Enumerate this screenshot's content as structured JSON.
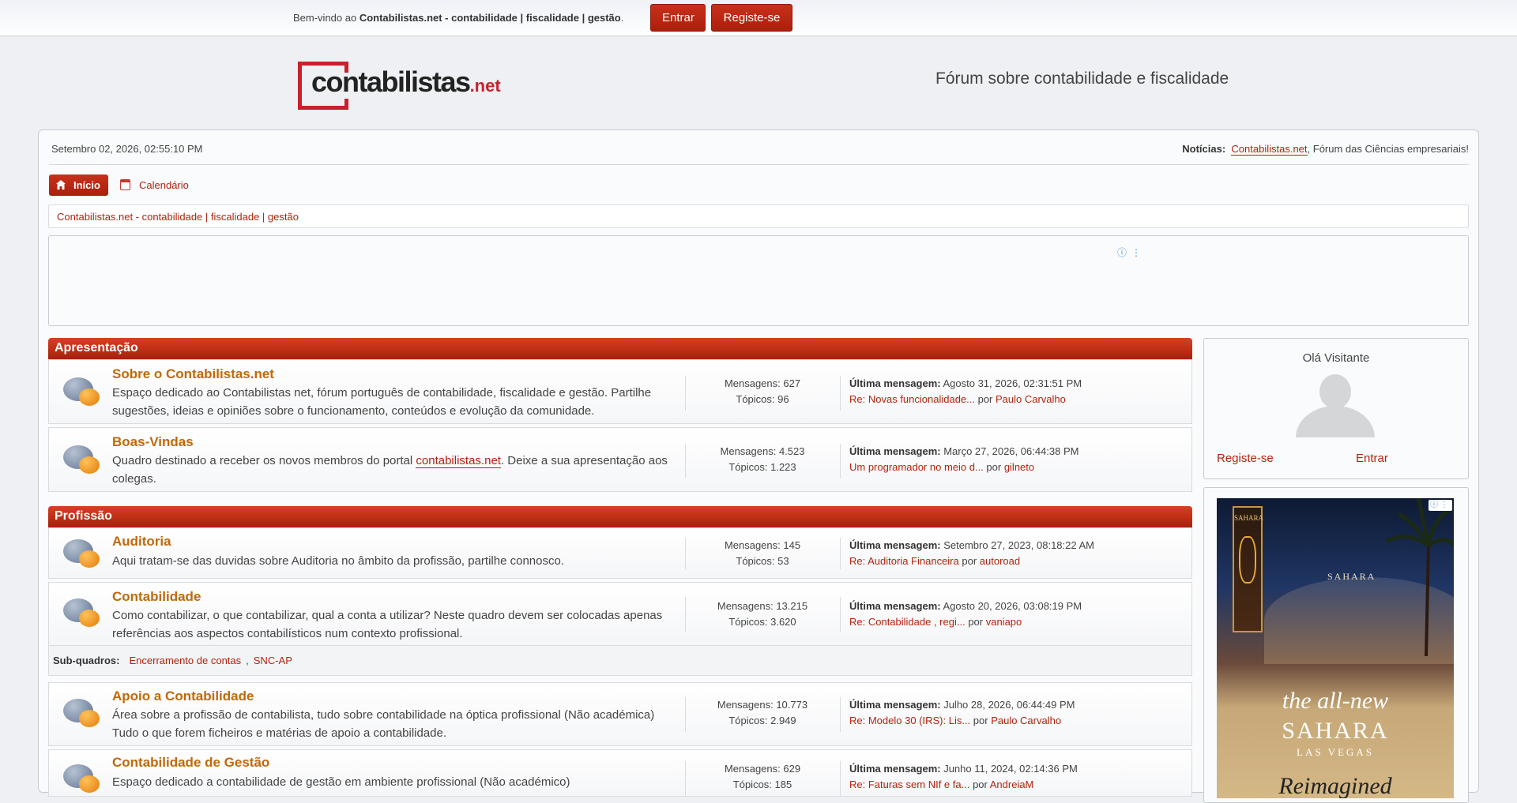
{
  "topbar": {
    "welcome_prefix": "Bem-vindo ao ",
    "site_name": "Contabilistas.net - contabilidade | fiscalidade | gestão",
    "welcome_suffix": ".",
    "login_label": "Entrar",
    "register_label": "Registe-se"
  },
  "header": {
    "logo_word": "contabilistas",
    "logo_tld": ".net",
    "tagline": "Fórum sobre contabilidade e fiscalidade"
  },
  "info": {
    "datetime": "Setembro 02, 2026, 02:55:10 PM",
    "news_label": "Notícias:",
    "news_link": "Contabilistas.net",
    "news_text": ", Fórum das Ciências empresariais!"
  },
  "nav": {
    "home_label": "Início",
    "calendar_label": "Calendário"
  },
  "breadcrumb": {
    "item": "Contabilistas.net - contabilidade | fiscalidade | gestão"
  },
  "ad": {
    "info_icons": "ⓘ⋮"
  },
  "categories": {
    "apresentacao": "Apresentação",
    "profissao": "Profissão"
  },
  "boards": [
    {
      "title": "Sobre o Contabilistas.net",
      "description": "Espaço dedicado ao Contabilistas net, fórum português de contabilidade, fiscalidade e gestão. Partilhe sugestões, ideias e opiniões sobre o funcionamento, conteúdos e evolução da comunidade.",
      "posts": "Mensagens: 627",
      "topics": "Tópicos: 96",
      "last_label": "Última mensagem:",
      "last_date": " Agosto 31, 2026, 02:31:51 PM",
      "last_topic": "Re: Novas funcionalidade...",
      "by": " por ",
      "last_user": "Paulo Carvalho"
    },
    {
      "title": "Boas-Vindas",
      "desc_prefix": "Quadro destinado a receber os novos membros do portal ",
      "desc_link": "contabilistas.net",
      "desc_suffix": ". Deixe a sua apresentação aos colegas.",
      "posts": "Mensagens: 4.523",
      "topics": "Tópicos: 1.223",
      "last_label": "Última mensagem:",
      "last_date": " Março 27, 2026, 06:44:38 PM",
      "last_topic": "Um programador no meio d...",
      "by": " por ",
      "last_user": "gilneto"
    },
    {
      "title": "Auditoria",
      "description": "Aqui tratam-se das duvidas sobre Auditoria no âmbito da profissão, partilhe connosco.",
      "posts": "Mensagens: 145",
      "topics": "Tópicos: 53",
      "last_label": "Última mensagem:",
      "last_date": " Setembro 27, 2023, 08:18:22 AM",
      "last_topic": "Re: Auditoria Financeira",
      "by": " por ",
      "last_user": "autoroad"
    },
    {
      "title": "Contabilidade",
      "description": "Como contabilizar, o que contabilizar, qual a conta a utilizar? Neste quadro devem ser colocadas apenas referências aos aspectos contabilísticos num contexto profissional.",
      "posts": "Mensagens: 13.215",
      "topics": "Tópicos: 3.620",
      "last_label": "Última mensagem:",
      "last_date": " Agosto 20, 2026, 03:08:19 PM",
      "last_topic": "Re: Contabilidade , regi...",
      "by": " por ",
      "last_user": "vaniapo"
    },
    {
      "title": "Apoio a Contabilidade",
      "description": "Área sobre a profissão de contabilista, tudo sobre contabilidade na óptica profissional (Não académica) Tudo o que forem ficheiros e matérias de apoio a contabilidade.",
      "posts": "Mensagens: 10.773",
      "topics": "Tópicos: 2.949",
      "last_label": "Última mensagem:",
      "last_date": " Julho 28, 2026, 06:44:49 PM",
      "last_topic": "Re: Modelo 30 (IRS): Lis...",
      "by": " por ",
      "last_user": "Paulo Carvalho"
    },
    {
      "title": "Contabilidade de Gestão",
      "description": "Espaço dedicado a contabilidade de gestão em ambiente profissional (Não académico)",
      "posts": "Mensagens: 629",
      "topics": "Tópicos: 185",
      "last_label": "Última mensagem:",
      "last_date": " Junho 11, 2024, 02:14:36 PM",
      "last_topic": "Re: Faturas sem NIf e fa...",
      "by": " por ",
      "last_user": "AndreiaM"
    }
  ],
  "subboards": {
    "label": "Sub-quadros:",
    "item1": "Encerramento de contas",
    "separator": ",",
    "item2": "SNC-AP"
  },
  "userbox": {
    "greeting": "Olá Visitante",
    "register_label": "Registe-se",
    "login_label": "Entrar"
  },
  "sidead": {
    "tower_text": "SAHARA",
    "building_text": "SAHARA",
    "line1": "the all-new",
    "line2": "SAHARA",
    "line3": "LAS VEGAS",
    "line4": "Reimagined",
    "icons": "ⓘ⋮"
  },
  "colors": {
    "accent": "#b3230e",
    "board_title": "#c0690a",
    "logo_red": "#c8202c"
  }
}
